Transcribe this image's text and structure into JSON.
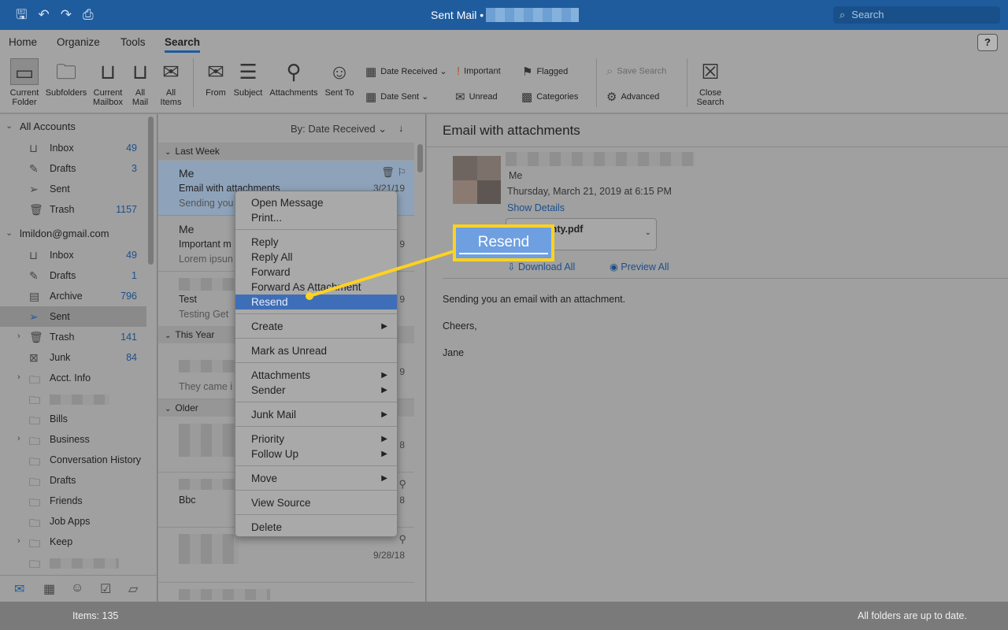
{
  "window": {
    "title": "Sent Mail •",
    "search_placeholder": "Search",
    "quick_icons": [
      "save-icon",
      "undo-icon",
      "redo-icon",
      "print-icon"
    ]
  },
  "tabs": [
    {
      "label": "Home"
    },
    {
      "label": "Organize"
    },
    {
      "label": "Tools"
    },
    {
      "label": "Search"
    }
  ],
  "help_label": "?",
  "ribbon": {
    "current_folder": "Current Folder",
    "subfolders": "Subfolders",
    "current_mailbox": "Current Mailbox",
    "all_mail": "All Mail",
    "all_items": "All Items",
    "from": "From",
    "subject": "Subject",
    "attachments": "Attachments",
    "sent_to": "Sent To",
    "date_received": "Date Received",
    "date_sent": "Date Sent",
    "important": "Important",
    "unread": "Unread",
    "flagged": "Flagged",
    "categories": "Categories",
    "save_search": "Save Search",
    "advanced": "Advanced",
    "close_search": "Close Search"
  },
  "folders": {
    "all_accounts": "All Accounts",
    "all_inbox": {
      "label": "Inbox",
      "count": "49"
    },
    "all_drafts": {
      "label": "Drafts",
      "count": "3"
    },
    "all_sent": {
      "label": "Sent"
    },
    "all_trash": {
      "label": "Trash",
      "count": "1157"
    },
    "account": "lmildon@gmail.com",
    "inbox": {
      "label": "Inbox",
      "count": "49"
    },
    "drafts": {
      "label": "Drafts",
      "count": "1"
    },
    "archive": {
      "label": "Archive",
      "count": "796"
    },
    "sent": {
      "label": "Sent"
    },
    "trash": {
      "label": "Trash",
      "count": "141"
    },
    "junk": {
      "label": "Junk",
      "count": "84"
    },
    "acct_info": "Acct. Info",
    "bills": "Bills",
    "business": "Business",
    "conversation_history": "Conversation History",
    "drafts2": "Drafts",
    "friends": "Friends",
    "job_apps": "Job Apps",
    "keep": "Keep"
  },
  "list": {
    "sort_label": "By: Date Received",
    "groups": {
      "last_week": "Last Week",
      "this_year": "This Year",
      "older": "Older"
    },
    "messages": [
      {
        "from": "Me",
        "subject": "Email with attachments",
        "preview": "Sending you",
        "date": "3/21/19"
      },
      {
        "from": "Me",
        "subject": "Important m",
        "preview": "Lorem ipsun",
        "date": "9"
      },
      {
        "from": "",
        "subject": "Test",
        "preview": "Testing Get",
        "date": "9"
      },
      {
        "from": "",
        "subject": "",
        "preview": "They came i",
        "date": "9"
      },
      {
        "from": "",
        "subject": "",
        "preview": "",
        "date": "8"
      },
      {
        "from": "",
        "subject": "Bbc",
        "preview": "",
        "date": "8"
      },
      {
        "from": "",
        "subject": "",
        "preview": "",
        "date": "9/28/18"
      }
    ]
  },
  "reading": {
    "subject": "Email with attachments",
    "sender": "Me",
    "date": "Thursday, March 21, 2019 at 6:15 PM",
    "show_details": "Show Details",
    "attachment_name": "rranty.pdf",
    "attachment_size": "MB",
    "download_all": "Download All",
    "preview_all": "Preview All",
    "body": [
      "Sending you an email with an attachment.",
      "Cheers,",
      "Jane"
    ]
  },
  "context_menu": {
    "open_message": "Open Message",
    "print": "Print...",
    "reply": "Reply",
    "reply_all": "Reply All",
    "forward": "Forward",
    "forward_attachment": "Forward As Attachment",
    "resend": "Resend",
    "create": "Create",
    "mark_unread": "Mark as Unread",
    "attachments": "Attachments",
    "sender": "Sender",
    "junk_mail": "Junk Mail",
    "priority": "Priority",
    "follow_up": "Follow Up",
    "move": "Move",
    "view_source": "View Source",
    "delete": "Delete"
  },
  "callout": {
    "label": "Resend",
    "color": "#ffd21f"
  },
  "status": {
    "items": "Items: 135",
    "sync": "All folders are up to date."
  },
  "colors": {
    "titlebar": "#1f5c9e",
    "link": "#1c4f8b",
    "highlight": "#3f6eb8"
  }
}
